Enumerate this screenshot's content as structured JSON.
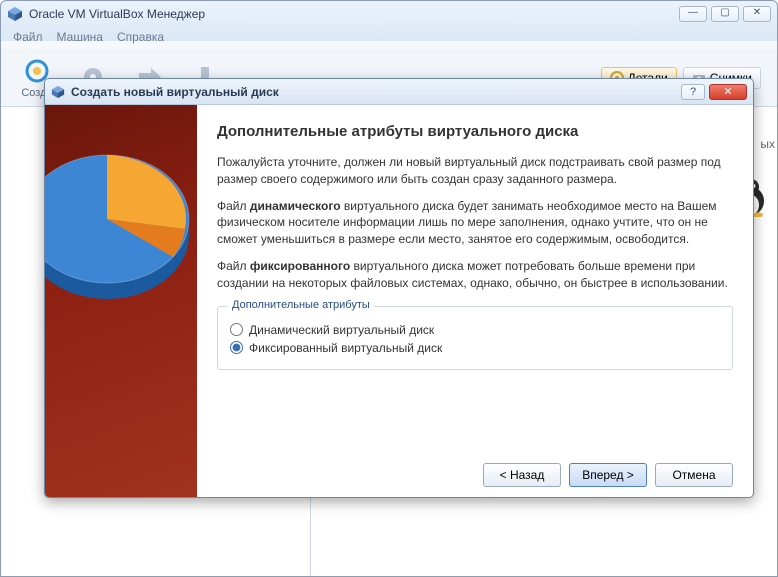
{
  "window": {
    "title": "Oracle VM VirtualBox Менеджер"
  },
  "menu": {
    "file": "Файл",
    "machine": "Машина",
    "help": "Справка"
  },
  "toolbar": {
    "create": "Созда"
  },
  "tabs": {
    "details": "Детали",
    "snapshots": "Снимки"
  },
  "detail_hint_suffix": "ых",
  "dialog": {
    "title": "Создать новый виртуальный диск",
    "heading": "Дополнительные атрибуты виртуального диска",
    "p1": "Пожалуйста уточните, должен ли новый виртуальный диск подстраивать свой размер под размер своего содержимого или быть создан сразу заданного размера.",
    "p2a": "Файл ",
    "p2b": "динамического",
    "p2c": " виртуального диска будет занимать необходимое место на Вашем физическом носителе информации лишь по мере заполнения, однако учтите, что он не сможет уменьшиться в размере если место, занятое его содержимым, освободится.",
    "p3a": "Файл ",
    "p3b": "фиксированного",
    "p3c": " виртуального диска может потребовать больше времени при создании на некоторых файловых системах, однако, обычно, он быстрее в использовании.",
    "group_legend": "Дополнительные атрибуты",
    "opt_dynamic": "Динамический виртуальный диск",
    "opt_fixed": "Фиксированный виртуальный диск",
    "btn_back": "< Назад",
    "btn_next": "Вперед >",
    "btn_cancel": "Отмена"
  }
}
